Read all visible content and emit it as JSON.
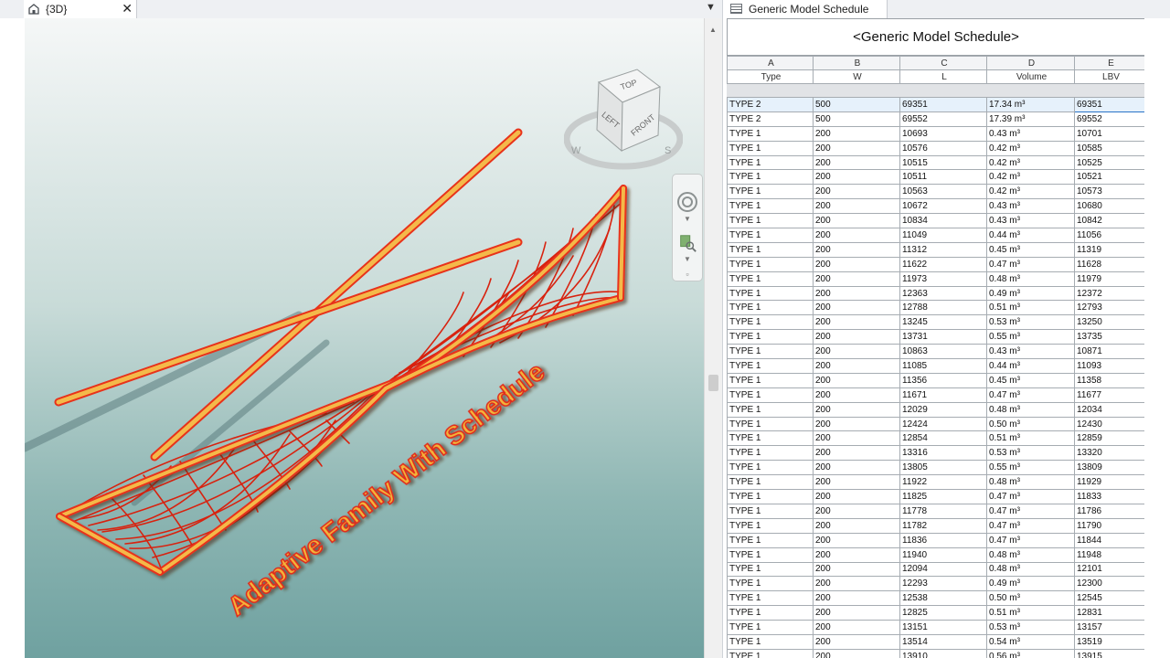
{
  "view": {
    "tab_label": "{3D}",
    "overlay_text": "Adaptive Family With Schedule",
    "viewcube": {
      "top_label": "TOP",
      "left_label": "LEFT",
      "front_label": "FRONT",
      "compass_w": "W",
      "compass_s": "S"
    }
  },
  "schedule": {
    "tab_label": "Generic Model Schedule",
    "title": "<Generic Model Schedule>",
    "column_letters": [
      "A",
      "B",
      "C",
      "D",
      "E"
    ],
    "column_headers": [
      "Type",
      "W",
      "L",
      "Volume",
      "LBV"
    ],
    "rows": [
      [
        "TYPE 2",
        "500",
        "69351",
        "17.34 m³",
        "69351"
      ],
      [
        "TYPE 2",
        "500",
        "69552",
        "17.39 m³",
        "69552"
      ],
      [
        "TYPE 1",
        "200",
        "10693",
        "0.43 m³",
        "10701"
      ],
      [
        "TYPE 1",
        "200",
        "10576",
        "0.42 m³",
        "10585"
      ],
      [
        "TYPE 1",
        "200",
        "10515",
        "0.42 m³",
        "10525"
      ],
      [
        "TYPE 1",
        "200",
        "10511",
        "0.42 m³",
        "10521"
      ],
      [
        "TYPE 1",
        "200",
        "10563",
        "0.42 m³",
        "10573"
      ],
      [
        "TYPE 1",
        "200",
        "10672",
        "0.43 m³",
        "10680"
      ],
      [
        "TYPE 1",
        "200",
        "10834",
        "0.43 m³",
        "10842"
      ],
      [
        "TYPE 1",
        "200",
        "11049",
        "0.44 m³",
        "11056"
      ],
      [
        "TYPE 1",
        "200",
        "11312",
        "0.45 m³",
        "11319"
      ],
      [
        "TYPE 1",
        "200",
        "11622",
        "0.47 m³",
        "11628"
      ],
      [
        "TYPE 1",
        "200",
        "11973",
        "0.48 m³",
        "11979"
      ],
      [
        "TYPE 1",
        "200",
        "12363",
        "0.49 m³",
        "12372"
      ],
      [
        "TYPE 1",
        "200",
        "12788",
        "0.51 m³",
        "12793"
      ],
      [
        "TYPE 1",
        "200",
        "13245",
        "0.53 m³",
        "13250"
      ],
      [
        "TYPE 1",
        "200",
        "13731",
        "0.55 m³",
        "13735"
      ],
      [
        "TYPE 1",
        "200",
        "10863",
        "0.43 m³",
        "10871"
      ],
      [
        "TYPE 1",
        "200",
        "11085",
        "0.44 m³",
        "11093"
      ],
      [
        "TYPE 1",
        "200",
        "11356",
        "0.45 m³",
        "11358"
      ],
      [
        "TYPE 1",
        "200",
        "11671",
        "0.47 m³",
        "11677"
      ],
      [
        "TYPE 1",
        "200",
        "12029",
        "0.48 m³",
        "12034"
      ],
      [
        "TYPE 1",
        "200",
        "12424",
        "0.50 m³",
        "12430"
      ],
      [
        "TYPE 1",
        "200",
        "12854",
        "0.51 m³",
        "12859"
      ],
      [
        "TYPE 1",
        "200",
        "13316",
        "0.53 m³",
        "13320"
      ],
      [
        "TYPE 1",
        "200",
        "13805",
        "0.55 m³",
        "13809"
      ],
      [
        "TYPE 1",
        "200",
        "11922",
        "0.48 m³",
        "11929"
      ],
      [
        "TYPE 1",
        "200",
        "11825",
        "0.47 m³",
        "11833"
      ],
      [
        "TYPE 1",
        "200",
        "11778",
        "0.47 m³",
        "11786"
      ],
      [
        "TYPE 1",
        "200",
        "11782",
        "0.47 m³",
        "11790"
      ],
      [
        "TYPE 1",
        "200",
        "11836",
        "0.47 m³",
        "11844"
      ],
      [
        "TYPE 1",
        "200",
        "11940",
        "0.48 m³",
        "11948"
      ],
      [
        "TYPE 1",
        "200",
        "12094",
        "0.48 m³",
        "12101"
      ],
      [
        "TYPE 1",
        "200",
        "12293",
        "0.49 m³",
        "12300"
      ],
      [
        "TYPE 1",
        "200",
        "12538",
        "0.50 m³",
        "12545"
      ],
      [
        "TYPE 1",
        "200",
        "12825",
        "0.51 m³",
        "12831"
      ],
      [
        "TYPE 1",
        "200",
        "13151",
        "0.53 m³",
        "13157"
      ],
      [
        "TYPE 1",
        "200",
        "13514",
        "0.54 m³",
        "13519"
      ],
      [
        "TYPE 1",
        "200",
        "13910",
        "0.56 m³",
        "13915"
      ]
    ]
  },
  "colors": {
    "accent": "#2a73c7",
    "member_fill": "#f0a830",
    "member_edge": "#e02a10"
  }
}
